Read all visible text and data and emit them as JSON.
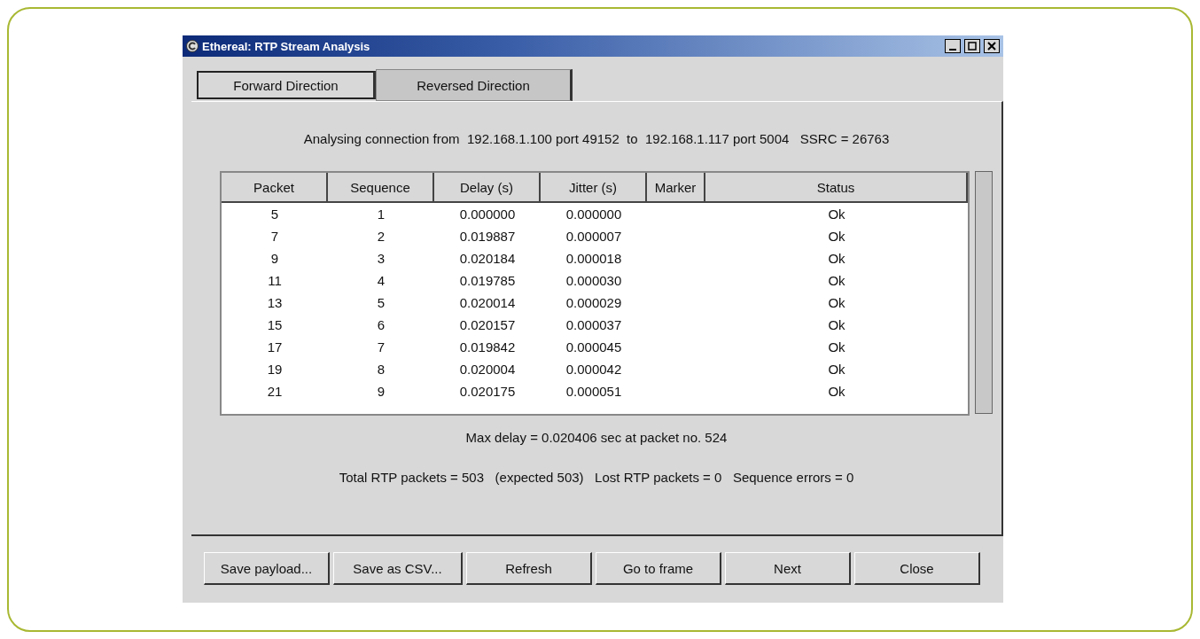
{
  "window": {
    "title": "Ethereal: RTP Stream Analysis"
  },
  "tabs": [
    {
      "label": "Forward Direction",
      "selected": true
    },
    {
      "label": "Reversed Direction",
      "selected": false
    }
  ],
  "connection": "Analysing connection from  192.168.1.100 port 49152  to  192.168.1.117 port 5004   SSRC = 26763",
  "table": {
    "columns": [
      "Packet",
      "Sequence",
      "Delay (s)",
      "Jitter (s)",
      "Marker",
      "Status"
    ],
    "rows": [
      [
        "5",
        "1",
        "0.000000",
        "0.000000",
        "",
        "Ok"
      ],
      [
        "7",
        "2",
        "0.019887",
        "0.000007",
        "",
        "Ok"
      ],
      [
        "9",
        "3",
        "0.020184",
        "0.000018",
        "",
        "Ok"
      ],
      [
        "11",
        "4",
        "0.019785",
        "0.000030",
        "",
        "Ok"
      ],
      [
        "13",
        "5",
        "0.020014",
        "0.000029",
        "",
        "Ok"
      ],
      [
        "15",
        "6",
        "0.020157",
        "0.000037",
        "",
        "Ok"
      ],
      [
        "17",
        "7",
        "0.019842",
        "0.000045",
        "",
        "Ok"
      ],
      [
        "19",
        "8",
        "0.020004",
        "0.000042",
        "",
        "Ok"
      ],
      [
        "21",
        "9",
        "0.020175",
        "0.000051",
        "",
        "Ok"
      ]
    ]
  },
  "max_delay": "Max delay = 0.020406 sec at packet no. 524",
  "totals": "Total RTP packets = 503   (expected 503)   Lost RTP packets = 0   Sequence errors = 0",
  "buttons": [
    "Save payload...",
    "Save as CSV...",
    "Refresh",
    "Go to frame",
    "Next",
    "Close"
  ]
}
